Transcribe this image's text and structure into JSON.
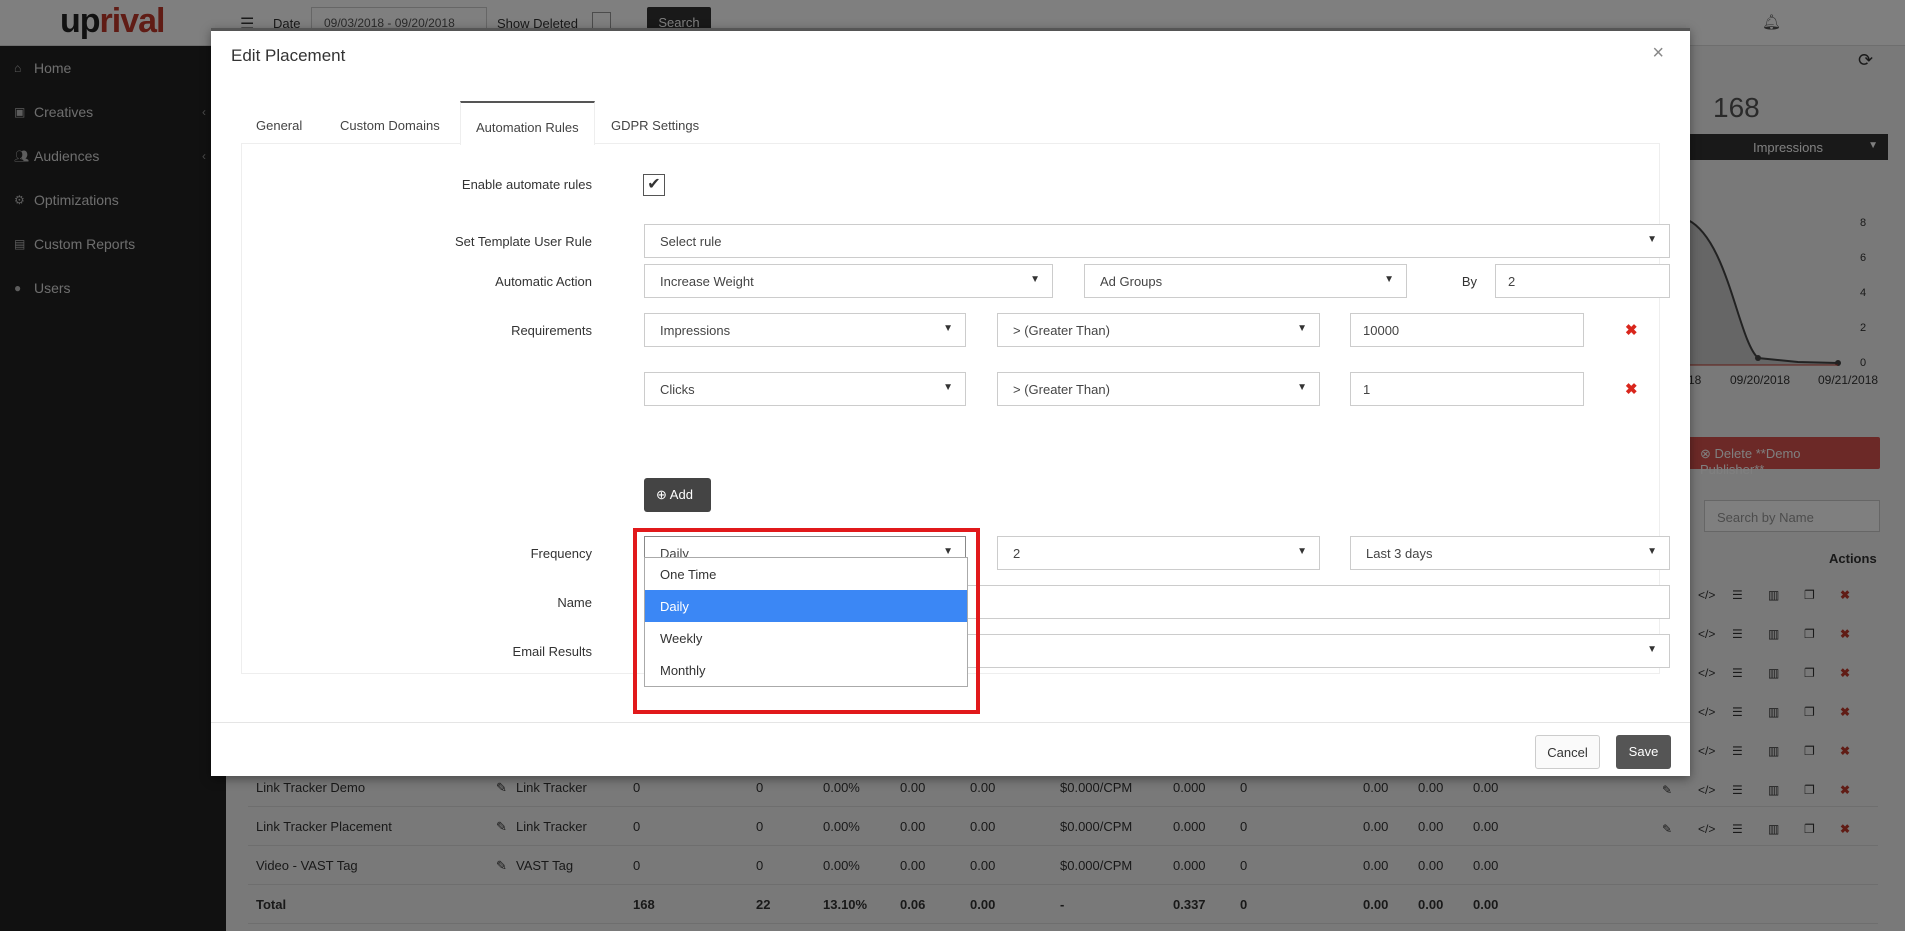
{
  "app": {
    "logo_main": "uprival",
    "logo_red": "up",
    "logo_rest": "rival"
  },
  "topbar": {
    "date_label": "Date",
    "date_value": "09/03/2018 - 09/20/2018",
    "show_deleted": "Show Deleted",
    "search_button": "Search"
  },
  "sidebar": {
    "items": [
      {
        "label": "Home",
        "icon": "home-icon"
      },
      {
        "label": "Creatives",
        "icon": "image-icon"
      },
      {
        "label": "Audiences",
        "icon": "users-icon"
      },
      {
        "label": "Optimizations",
        "icon": "gears-icon"
      },
      {
        "label": "Custom Reports",
        "icon": "file-icon"
      },
      {
        "label": "Users",
        "icon": "user-icon"
      }
    ]
  },
  "background": {
    "stat_value": "168",
    "stat_metric": "Impressions",
    "chart_ticks": [
      "8",
      "6",
      "4",
      "2",
      "0"
    ],
    "chart_dates": [
      "18",
      "09/20/2018",
      "09/21/2018"
    ],
    "delete_button": "Delete **Demo Publisher**",
    "search_placeholder": "Search by Name",
    "actions_header": "Actions",
    "rows": [
      {
        "name": "Link Tracker Demo",
        "type": "Link Tracker",
        "c1": "0",
        "c2": "0",
        "c3": "0.00%",
        "c4": "0.00",
        "c5": "0.00",
        "c6": "$0.000/CPM",
        "c7": "0.000",
        "c8": "0",
        "c9": "0.00",
        "c10": "0.00",
        "c11": "0.00"
      },
      {
        "name": "Link Tracker Placement",
        "type": "Link Tracker",
        "c1": "0",
        "c2": "0",
        "c3": "0.00%",
        "c4": "0.00",
        "c5": "0.00",
        "c6": "$0.000/CPM",
        "c7": "0.000",
        "c8": "0",
        "c9": "0.00",
        "c10": "0.00",
        "c11": "0.00"
      },
      {
        "name": "Video - VAST Tag",
        "type": "VAST Tag",
        "c1": "0",
        "c2": "0",
        "c3": "0.00%",
        "c4": "0.00",
        "c5": "0.00",
        "c6": "$0.000/CPM",
        "c7": "0.000",
        "c8": "0",
        "c9": "0.00",
        "c10": "0.00",
        "c11": "0.00"
      }
    ],
    "total": {
      "name": "Total",
      "c1": "168",
      "c2": "22",
      "c3": "13.10%",
      "c4": "0.06",
      "c5": "0.00",
      "c6": "-",
      "c7": "0.337",
      "c8": "0",
      "c9": "0.00",
      "c10": "0.00",
      "c11": "0.00"
    }
  },
  "modal": {
    "title": "Edit Placement",
    "close": "×",
    "tabs": [
      "General",
      "Custom Domains",
      "Automation Rules",
      "GDPR Settings"
    ],
    "active_tab": "Automation Rules",
    "enable_label": "Enable automate rules",
    "enable_checked": true,
    "template_label": "Set Template User Rule",
    "template_value": "Select rule",
    "action_label": "Automatic Action",
    "action_value": "Increase Weight",
    "action_target": "Ad Groups",
    "by_label": "By",
    "by_value": "2",
    "requirements_label": "Requirements",
    "requirements": [
      {
        "metric": "Impressions",
        "operator": "> (Greater Than)",
        "value": "10000"
      },
      {
        "metric": "Clicks",
        "operator": "> (Greater Than)",
        "value": "1"
      }
    ],
    "add_button": "Add",
    "frequency_label": "Frequency",
    "frequency_value": "Daily",
    "frequency_count": "2",
    "frequency_period": "Last 3 days",
    "frequency_options": [
      "One Time",
      "Daily",
      "Weekly",
      "Monthly"
    ],
    "frequency_selected": "Daily",
    "name_label": "Name",
    "name_value": "",
    "email_label": "Email Results",
    "email_value": "",
    "cancel_button": "Cancel",
    "save_button": "Save"
  },
  "colors": {
    "accent": "#3b87f5",
    "highlight": "#e1191b",
    "danger": "#d9534f",
    "sidebar": "#222222"
  }
}
